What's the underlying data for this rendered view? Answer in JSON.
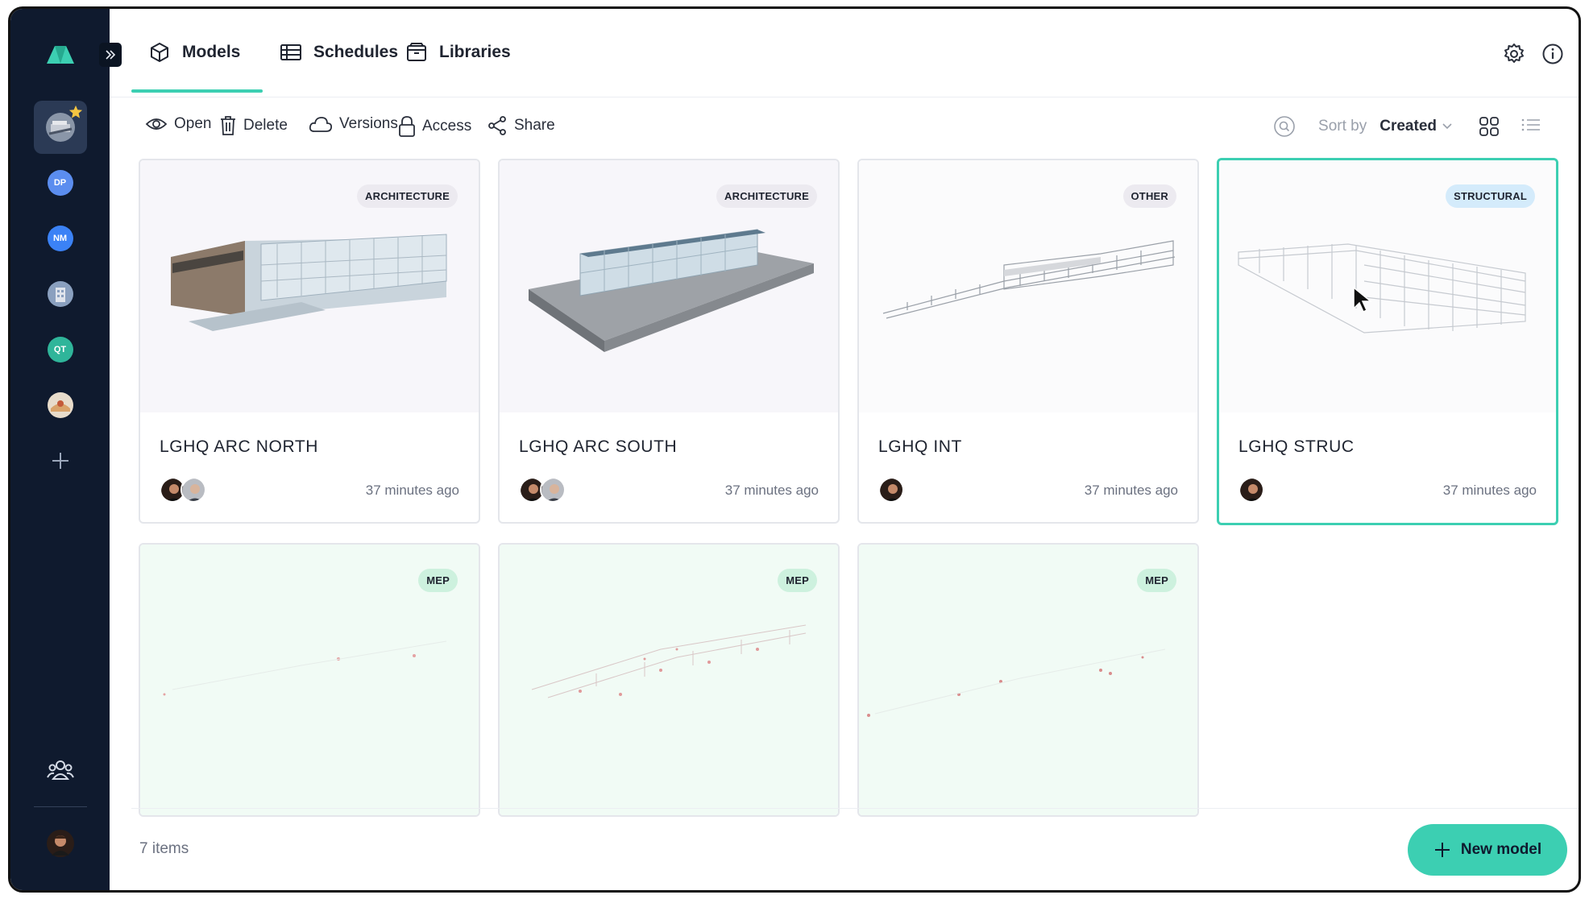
{
  "sidebar": {
    "workspaces": [
      {
        "label": "",
        "color": "#6b7a8e",
        "kind": "image"
      },
      {
        "label": "DP",
        "color": "#5b8def"
      },
      {
        "label": "NM",
        "color": "#3b82f6"
      },
      {
        "label": "",
        "color": "#8aa0bf",
        "kind": "image"
      },
      {
        "label": "QT",
        "color": "#2fb59a"
      },
      {
        "label": "",
        "color": "#d9a36a",
        "kind": "image"
      }
    ]
  },
  "nav": {
    "tabs": [
      {
        "label": "Models",
        "icon": "cube-icon"
      },
      {
        "label": "Schedules",
        "icon": "table-icon"
      },
      {
        "label": "Libraries",
        "icon": "library-icon"
      }
    ]
  },
  "toolbar": {
    "open": "Open",
    "delete": "Delete",
    "versions": "Versions",
    "access": "Access",
    "share": "Share",
    "sort_label": "Sort by",
    "sort_value": "Created"
  },
  "cards": [
    {
      "title": "LGHQ ARC NORTH",
      "badge": "ARCHITECTURE",
      "time": "37 minutes ago",
      "avatars": 2
    },
    {
      "title": "LGHQ ARC SOUTH",
      "badge": "ARCHITECTURE",
      "time": "37 minutes ago",
      "avatars": 2
    },
    {
      "title": "LGHQ INT",
      "badge": "OTHER",
      "time": "37 minutes ago",
      "avatars": 1
    },
    {
      "title": "LGHQ STRUC",
      "badge": "STRUCTURAL",
      "time": "37 minutes ago",
      "avatars": 1,
      "selected": true
    },
    {
      "title": "",
      "badge": "MEP",
      "time": "",
      "avatars": 0
    },
    {
      "title": "",
      "badge": "MEP",
      "time": "",
      "avatars": 0
    },
    {
      "title": "",
      "badge": "MEP",
      "time": "",
      "avatars": 0
    }
  ],
  "footer": {
    "item_count": "7 items",
    "new_model": "New model"
  },
  "colors": {
    "accent": "#3ccfb2",
    "sidebar_bg": "#0f1a2e"
  }
}
